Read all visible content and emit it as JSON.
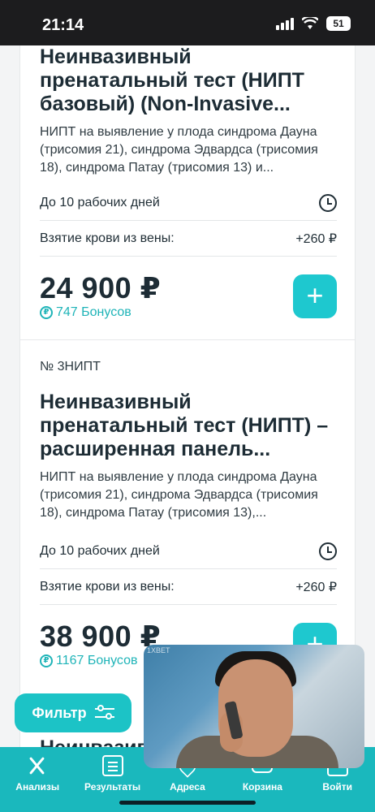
{
  "status_bar": {
    "time": "21:14",
    "battery": "51"
  },
  "cards": [
    {
      "title": "Неинвазивный пренатальный тест (НИПТ базовый) (Non-Invasive...",
      "description": "НИПТ на выявление у плода синдрома Дауна (трисомия 21), синдрома Эдвардса (трисомия 18), синдрома Патау (трисомия 13) и...",
      "duration": "До 10 рабочих дней",
      "blood_label": "Взятие крови из вены:",
      "blood_price": "+260 ₽",
      "price": "24 900 ₽",
      "bonus": "747 Бонусов",
      "add_label": "+"
    },
    {
      "code": "№ 3НИПТ",
      "title": "Неинвазивный пренатальный тест (НИПТ) – расширенная панель...",
      "description": "НИПТ на выявление у плода синдрома Дауна (трисомия 21), синдрома Эдвардса (трисомия 18), синдрома Патау (трисомия 13),...",
      "duration": "До 10 рабочих дней",
      "blood_label": "Взятие крови из вены:",
      "blood_price": "+260 ₽",
      "price": "38 900 ₽",
      "bonus": "1167 Бонусов",
      "add_label": "+"
    }
  ],
  "partial_title": "Неинвазив",
  "bonus_symbol": "₽",
  "filter": {
    "label": "Фильтр"
  },
  "video": {
    "watermark": "1XBET"
  },
  "nav": [
    {
      "label": "Анализы",
      "icon": "dna-icon"
    },
    {
      "label": "Результаты",
      "icon": "list-icon"
    },
    {
      "label": "Адреса",
      "icon": "location-icon"
    },
    {
      "label": "Корзина",
      "icon": "cart-icon"
    },
    {
      "label": "Войти",
      "icon": "user-icon"
    }
  ],
  "colors": {
    "accent": "#1ec8cf",
    "nav_bg": "#1ab8bd",
    "text": "#1d2c35"
  }
}
